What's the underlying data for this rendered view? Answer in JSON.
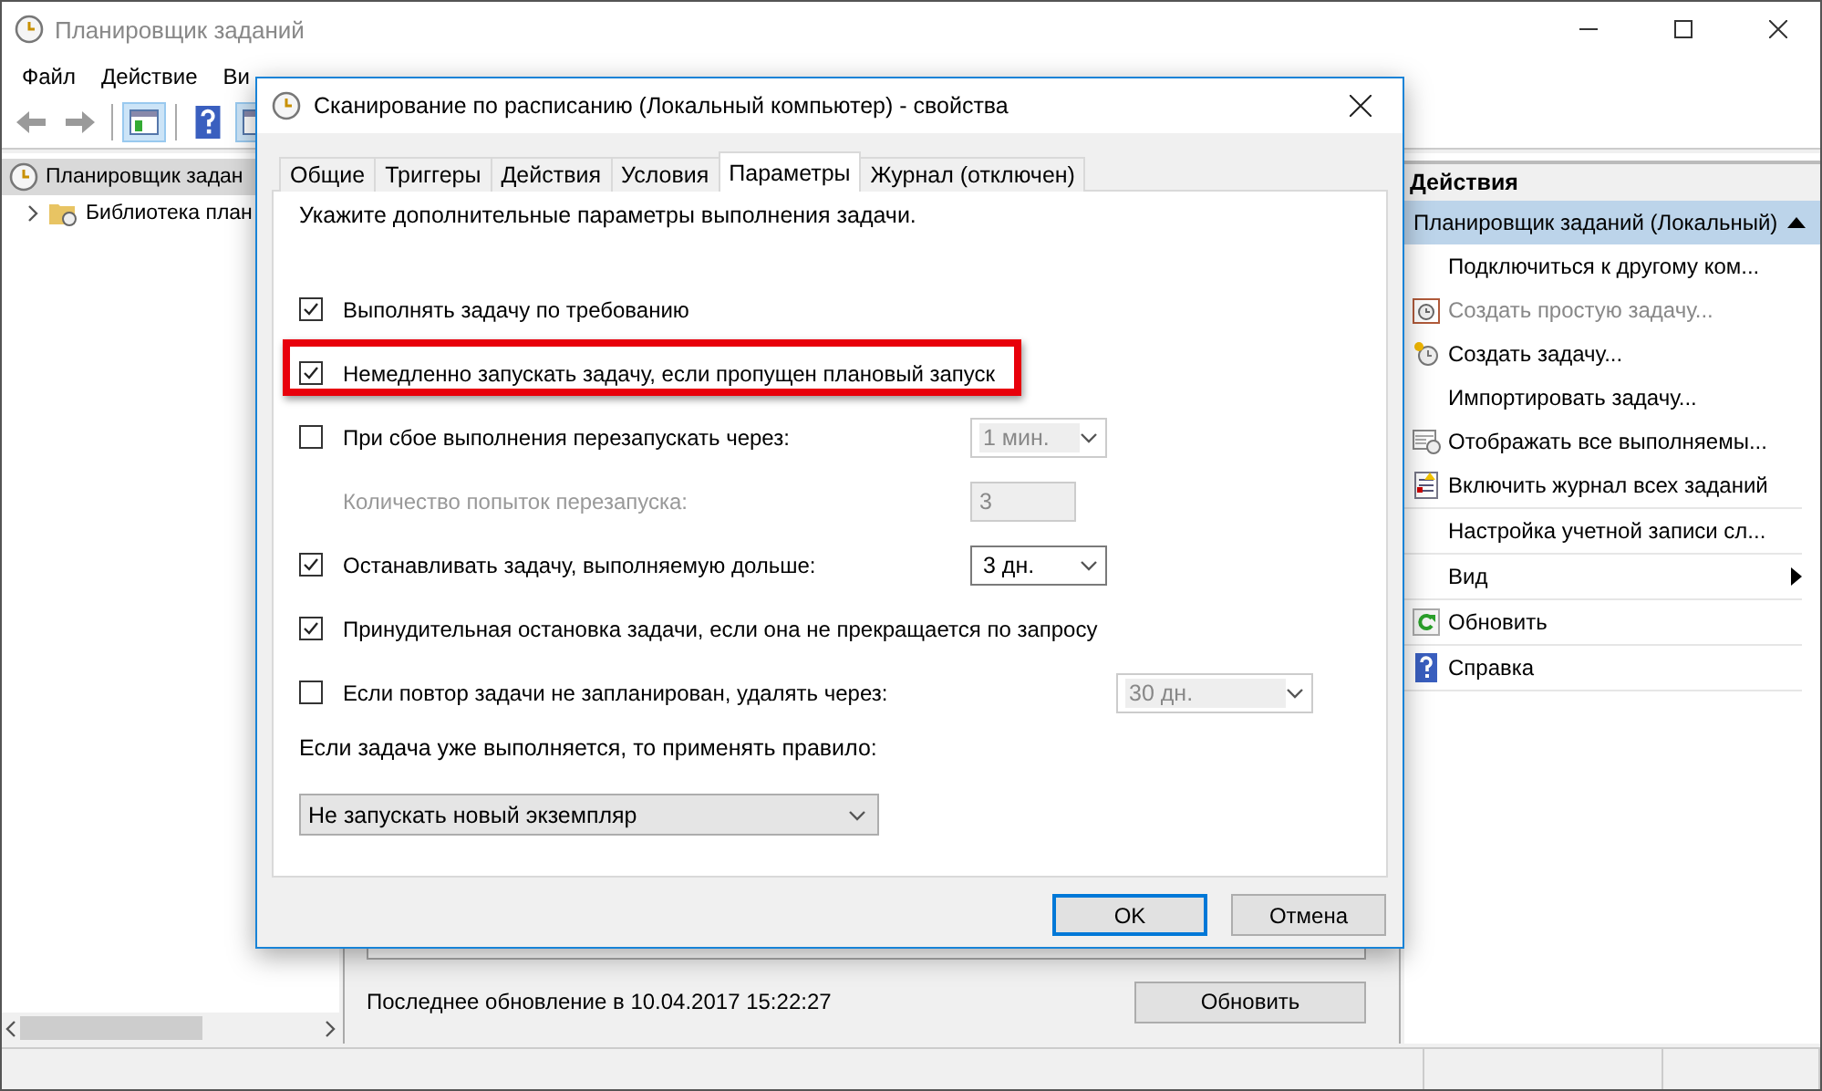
{
  "main_window": {
    "title": "Планировщик заданий"
  },
  "menu": [
    "Файл",
    "Действие",
    "Ви"
  ],
  "tree": [
    {
      "label": "Планировщик задан",
      "selected": true,
      "children": [
        {
          "label": "Библиотека план",
          "selected": false,
          "expanded": false
        }
      ]
    }
  ],
  "center": {
    "status_text": "Последнее обновление в 10.04.2017 15:22:27",
    "refresh_button": "Обновить"
  },
  "actions_pane": {
    "title": "Действия",
    "group": {
      "label": "Планировщик заданий (Локальный)",
      "expanded": true
    },
    "sections": [
      [
        {
          "label": "Подключиться к другому ком...",
          "disabled": false,
          "submenu": false
        },
        {
          "label": "Создать простую задачу...",
          "disabled": true,
          "submenu": false
        },
        {
          "label": "Создать задачу...",
          "disabled": false,
          "submenu": false
        },
        {
          "label": "Импортировать задачу...",
          "disabled": false,
          "submenu": false
        },
        {
          "label": "Отображать все выполняемы...",
          "disabled": false,
          "submenu": false
        },
        {
          "label": "Включить журнал всех заданий",
          "disabled": false,
          "submenu": false
        }
      ],
      [
        {
          "label": "Настройка учетной записи сл...",
          "disabled": false,
          "submenu": false
        }
      ],
      [
        {
          "label": "Вид",
          "disabled": false,
          "submenu": true
        }
      ],
      [
        {
          "label": "Обновить",
          "disabled": false,
          "submenu": false
        }
      ],
      [
        {
          "label": "Справка",
          "disabled": false,
          "submenu": false
        }
      ]
    ]
  },
  "dialog": {
    "title": "Сканирование по расписанию (Локальный компьютер) - свойства",
    "tabs": [
      {
        "label": "Общие",
        "selected": false
      },
      {
        "label": "Триггеры",
        "selected": false
      },
      {
        "label": "Действия",
        "selected": false
      },
      {
        "label": "Условия",
        "selected": false
      },
      {
        "label": "Параметры",
        "selected": true
      },
      {
        "label": "Журнал (отключен)",
        "selected": false
      }
    ],
    "intro": "Укажите дополнительные параметры выполнения задачи.",
    "options": [
      {
        "kind": "check",
        "label": "Выполнять задачу по требованию",
        "checked": true,
        "highlighted": false
      },
      {
        "kind": "check",
        "label": "Немедленно запускать задачу, если пропущен плановый запуск",
        "checked": true,
        "highlighted": true
      },
      {
        "kind": "check_select",
        "label": "При сбое выполнения перезапускать через:",
        "checked": false,
        "highlighted": false,
        "select": {
          "value": "1 мин.",
          "disabled": true
        }
      },
      {
        "kind": "label_spin",
        "label": "Количество попыток перезапуска:",
        "disabled": true,
        "spin": {
          "value": "3",
          "disabled": true
        }
      },
      {
        "kind": "check_select",
        "label": "Останавливать задачу, выполняемую дольше:",
        "checked": true,
        "highlighted": false,
        "select": {
          "value": "3 дн.",
          "disabled": false
        }
      },
      {
        "kind": "check",
        "label": "Принудительная остановка задачи, если она не прекращается по запросу",
        "checked": true,
        "highlighted": false
      },
      {
        "kind": "check_select_far",
        "label": "Если повтор задачи не запланирован, удалять через:",
        "checked": false,
        "highlighted": false,
        "select": {
          "value": "30 дн.",
          "disabled": true
        }
      }
    ],
    "rule_label": "Если задача уже выполняется, то применять правило:",
    "rule_select": "Не запускать новый экземпляр",
    "buttons": [
      {
        "label": "OK",
        "default": true
      },
      {
        "label": "Отмена",
        "default": false
      }
    ]
  }
}
